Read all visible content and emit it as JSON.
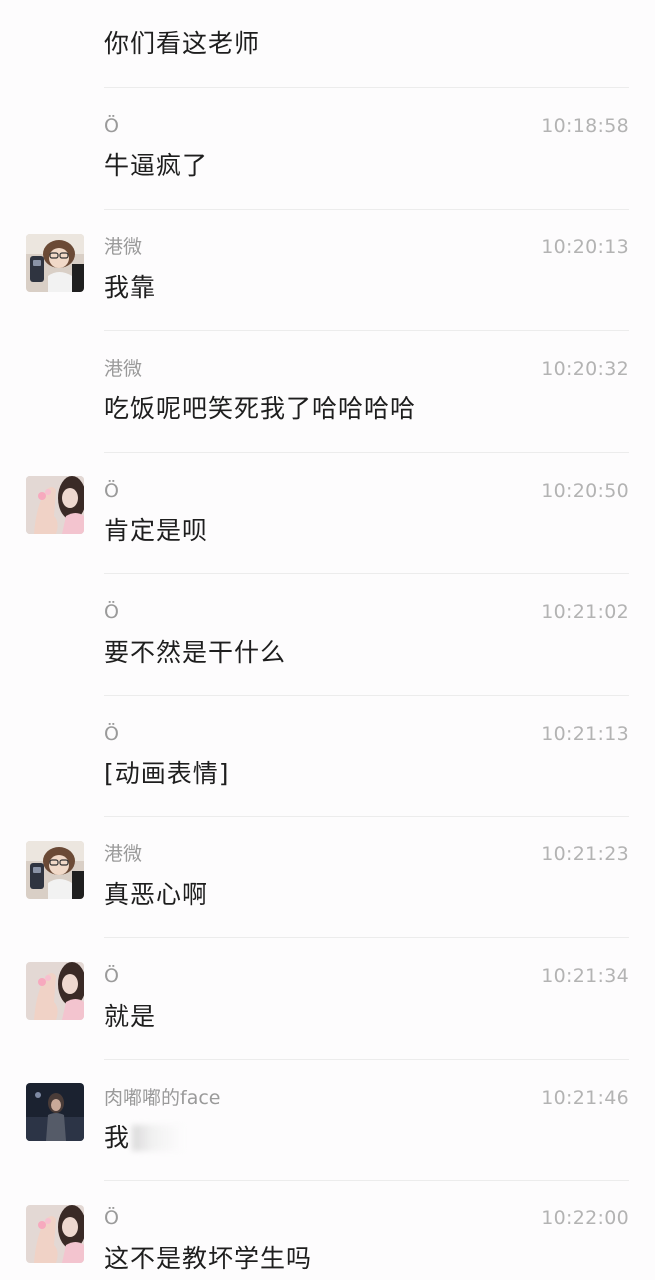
{
  "messages": [
    {
      "content": "你们看这老师"
    },
    {
      "sender": "Ö",
      "time": "10:18:58",
      "content": "牛逼疯了"
    },
    {
      "sender": "港微",
      "time": "10:20:13",
      "content": "我靠",
      "avatar": "avatar-gangwei"
    },
    {
      "sender": "港微",
      "time": "10:20:32",
      "content": "吃饭呢吧笑死我了哈哈哈哈"
    },
    {
      "sender": "Ö",
      "time": "10:20:50",
      "content": "肯定是呗",
      "avatar": "avatar-o"
    },
    {
      "sender": "Ö",
      "time": "10:21:02",
      "content": "要不然是干什么"
    },
    {
      "sender": "Ö",
      "time": "10:21:13",
      "content": "[动画表情]"
    },
    {
      "sender": "港微",
      "time": "10:21:23",
      "content": "真恶心啊",
      "avatar": "avatar-gangwei"
    },
    {
      "sender": "Ö",
      "time": "10:21:34",
      "content": "就是",
      "avatar": "avatar-o"
    },
    {
      "sender": "肉嘟嘟的face",
      "time": "10:21:46",
      "content": "我",
      "avatar": "avatar-rouduodu",
      "content_blurred": true
    },
    {
      "sender": "Ö",
      "time": "10:22:00",
      "content": "这不是教坏学生吗",
      "avatar": "avatar-o"
    }
  ],
  "colors": {
    "background": "#fdfcfd",
    "sender": "#9a9a9a",
    "time": "#b3b3b3",
    "text": "#1e1e1e",
    "divider": "#ececec"
  }
}
